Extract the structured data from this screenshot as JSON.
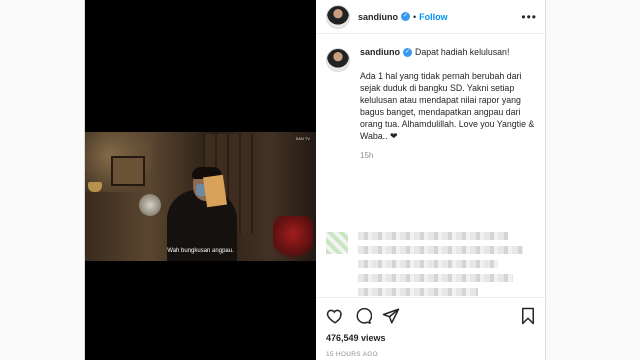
{
  "post": {
    "username": "sandiuno",
    "follow_label": "Follow",
    "dot": "•",
    "more_label": "•••",
    "caption_first_line": "Dapat hadiah kelulusan!",
    "caption_body": "Ada 1 hal yang tidak pernah berubah dari sejak duduk di bangku SD. Yakni setiap kelulusan atau mendapat nilai rapor yang bagus banget, mendapatkan angpau dari orang tua. Alhamdulillah. Love you Yangtie & Waba.. ❤",
    "caption_time": "15h",
    "views": "476,549 views",
    "posted_ago": "15 HOURS AGO"
  },
  "video": {
    "subtitle": "Wah bungkusan angpau.",
    "watermark": "SAN TV"
  },
  "colors": {
    "accent": "#0095f6",
    "verified": "#3897f0",
    "muted": "#8e8e8e"
  },
  "icons": {
    "like": "heart-icon",
    "comment": "comment-icon",
    "share": "share-icon",
    "save": "bookmark-icon",
    "verified": "verified-badge-icon"
  }
}
